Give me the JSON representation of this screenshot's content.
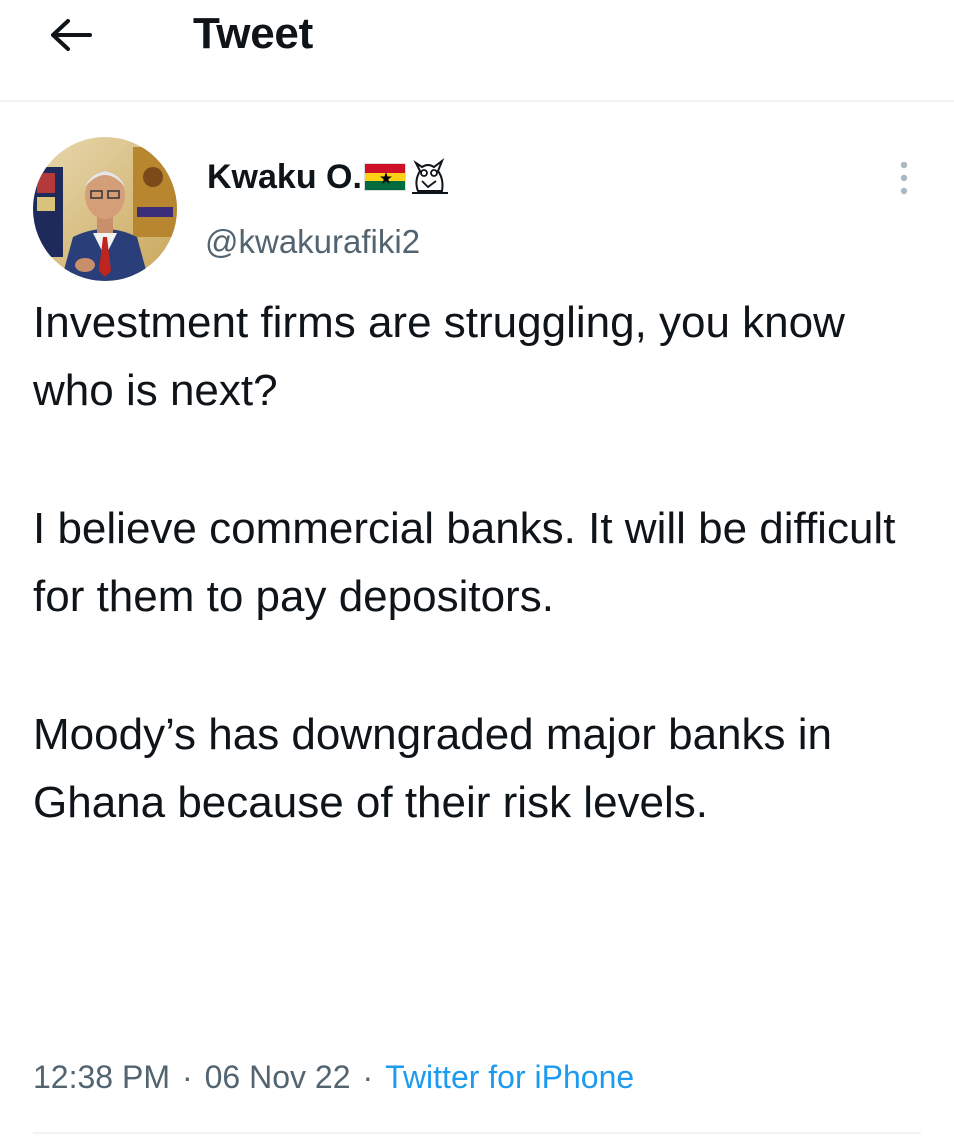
{
  "header": {
    "title": "Tweet",
    "back_icon": "arrow-left-icon"
  },
  "author": {
    "name": "Kwaku O.",
    "name_decorations": [
      "ghana-flag-icon",
      "owl-icon"
    ],
    "handle": "@kwakurafiki2",
    "avatar": "avatar"
  },
  "tweet": {
    "paragraphs": [
      "Investment firms are struggling, you know who is next?",
      "I believe commercial banks. It will be difficult for them to pay depositors.",
      "Moody’s has downgraded major banks in Ghana because of their risk levels."
    ]
  },
  "meta": {
    "time": "12:38 PM",
    "date": "06 Nov 22",
    "separator": "·",
    "source": "Twitter for iPhone"
  },
  "colors": {
    "text_primary": "#0f1419",
    "text_secondary": "#536471",
    "link": "#1d9bf0",
    "divider": "#eff3f4",
    "flag_red": "#ce1126",
    "flag_gold": "#fcd116",
    "flag_green": "#006b3f"
  },
  "icons": {
    "more": "more-vertical-icon"
  }
}
